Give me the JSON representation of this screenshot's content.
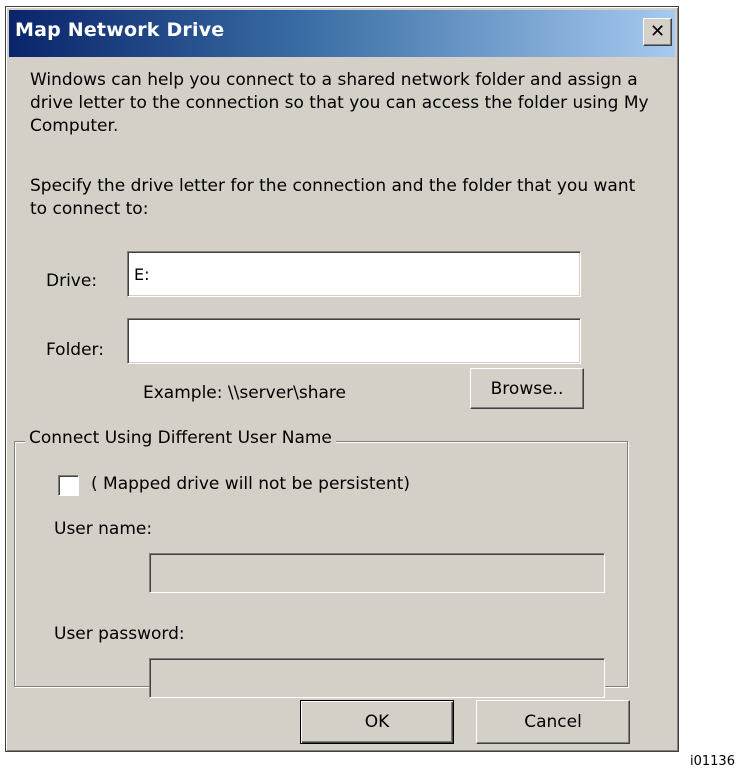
{
  "window": {
    "title": "Map Network Drive",
    "close_glyph": "✕",
    "close_icon": "close-icon"
  },
  "intro": {
    "paragraph1": "Windows can help you connect to a shared network folder and assign a drive letter to the connection so that you can access the folder using My Computer.",
    "paragraph2": "Specify the drive letter for the connection and the folder that you want to connect to:"
  },
  "drive": {
    "label": "Drive:",
    "value": "E:"
  },
  "folder": {
    "label": "Folder:",
    "value": "",
    "example": "Example: \\\\server\\share",
    "browse_label": "Browse.."
  },
  "credentials_group": {
    "title": "Connect Using Different User Name",
    "checkbox_label": "( Mapped drive will not be persistent)",
    "checkbox_checked": false,
    "user_name_label": "User name:",
    "user_name_value": "",
    "password_label": "User password:",
    "password_value": ""
  },
  "buttons": {
    "ok": "OK",
    "cancel": "Cancel"
  },
  "footnote": "i01136",
  "colors": {
    "dialog_face": "#d4d0c8",
    "titlebar_start": "#0a246a",
    "titlebar_end": "#a6caf0",
    "title_text": "#ffffff"
  }
}
